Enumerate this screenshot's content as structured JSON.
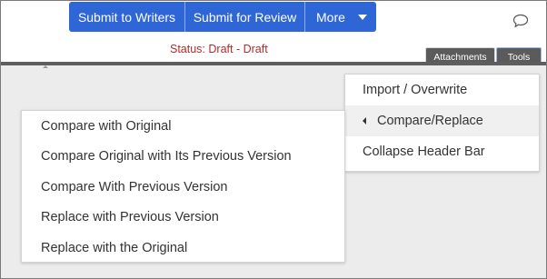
{
  "toolbar": {
    "submit_writers": "Submit to Writers",
    "submit_review": "Submit for Review",
    "more": "More"
  },
  "status": "Status: Draft - Draft",
  "tabs": {
    "attachments": "Attachments",
    "tools": "Tools"
  },
  "tools_menu": {
    "items": [
      "Import / Overwrite",
      "Compare/Replace",
      "Collapse Header Bar"
    ],
    "active": "Compare/Replace"
  },
  "compare_menu": {
    "items": [
      "Compare with Original",
      "Compare Original with Its Previous Version",
      "Compare With Previous Version",
      "Replace with Previous Version",
      "Replace with the Original"
    ]
  },
  "colors": {
    "accent": "#2e66d6",
    "status": "#b22b2b",
    "header_bar": "#5e5e5e",
    "workspace": "#ececec"
  },
  "icons": [
    "chat-bubble-icon",
    "chevron-down-icon",
    "submenu-arrow-left-icon"
  ]
}
